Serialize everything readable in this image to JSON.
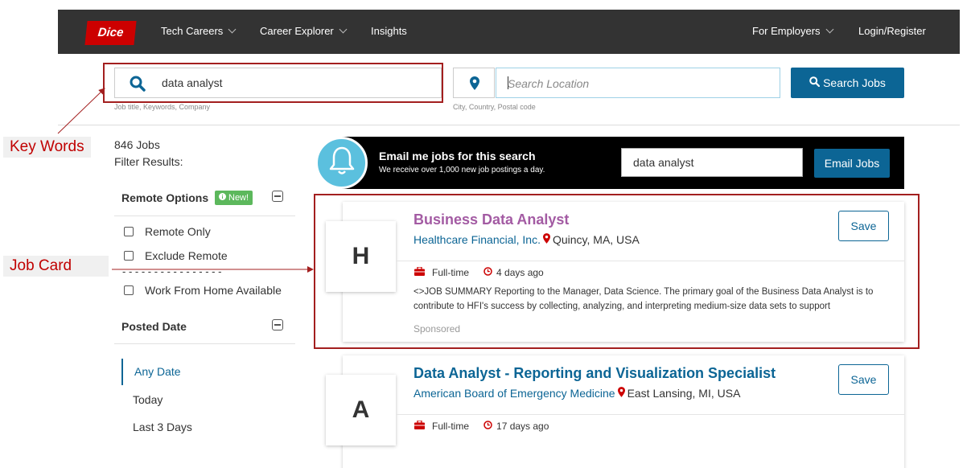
{
  "nav": {
    "logo": "Dice",
    "links": [
      "Tech Careers",
      "Career Explorer",
      "Insights"
    ],
    "employers": "For Employers",
    "login": "Login/Register"
  },
  "search": {
    "keyword_value": "data analyst",
    "keyword_hint": "Job title, Keywords, Company",
    "location_placeholder": "Search Location",
    "location_hint": "City, Country, Postal code",
    "button_label": "Search Jobs"
  },
  "annotations": {
    "keywords_label": "Key Words",
    "job_card_label": "Job Card"
  },
  "sidebar": {
    "job_count": "846 Jobs",
    "filter_label": "Filter Results:",
    "remote_heading": "Remote Options",
    "new_badge": "New!",
    "remote_only": "Remote Only",
    "exclude_remote": "Exclude Remote",
    "dash_separator": "- - - - - - - - - - - - - - - -",
    "wfh": "Work From Home Available",
    "posted_heading": "Posted Date",
    "date_options": [
      "Any Date",
      "Today",
      "Last 3 Days"
    ]
  },
  "email_banner": {
    "title": "Email me jobs for this search",
    "subtitle": "We receive over 1,000 new job postings a day.",
    "input_value": "data analyst",
    "button_label": "Email Jobs"
  },
  "jobs": [
    {
      "logo_letter": "H",
      "title": "Business Data Analyst",
      "company": "Healthcare Financial, Inc.",
      "location": "Quincy, MA, USA",
      "save_label": "Save",
      "type": "Full-time",
      "posted": "4 days ago",
      "description": "<>JOB SUMMARY Reporting to the Manager, Data Science. The primary goal of the Business Data Analyst is to contribute to HFI's success by collecting, analyzing, and interpreting medium-size data sets to support",
      "sponsored": "Sponsored"
    },
    {
      "logo_letter": "A",
      "title": "Data Analyst - Reporting and Visualization Specialist",
      "company": "American Board of Emergency Medicine",
      "location": "East Lansing, MI, USA",
      "save_label": "Save",
      "type": "Full-time",
      "posted": "17 days ago"
    }
  ],
  "colors": {
    "brand_red": "#cc0000",
    "primary_blue": "#0c6595",
    "visited_title": "#a35ba3",
    "annotation_red": "#a31f1f"
  }
}
